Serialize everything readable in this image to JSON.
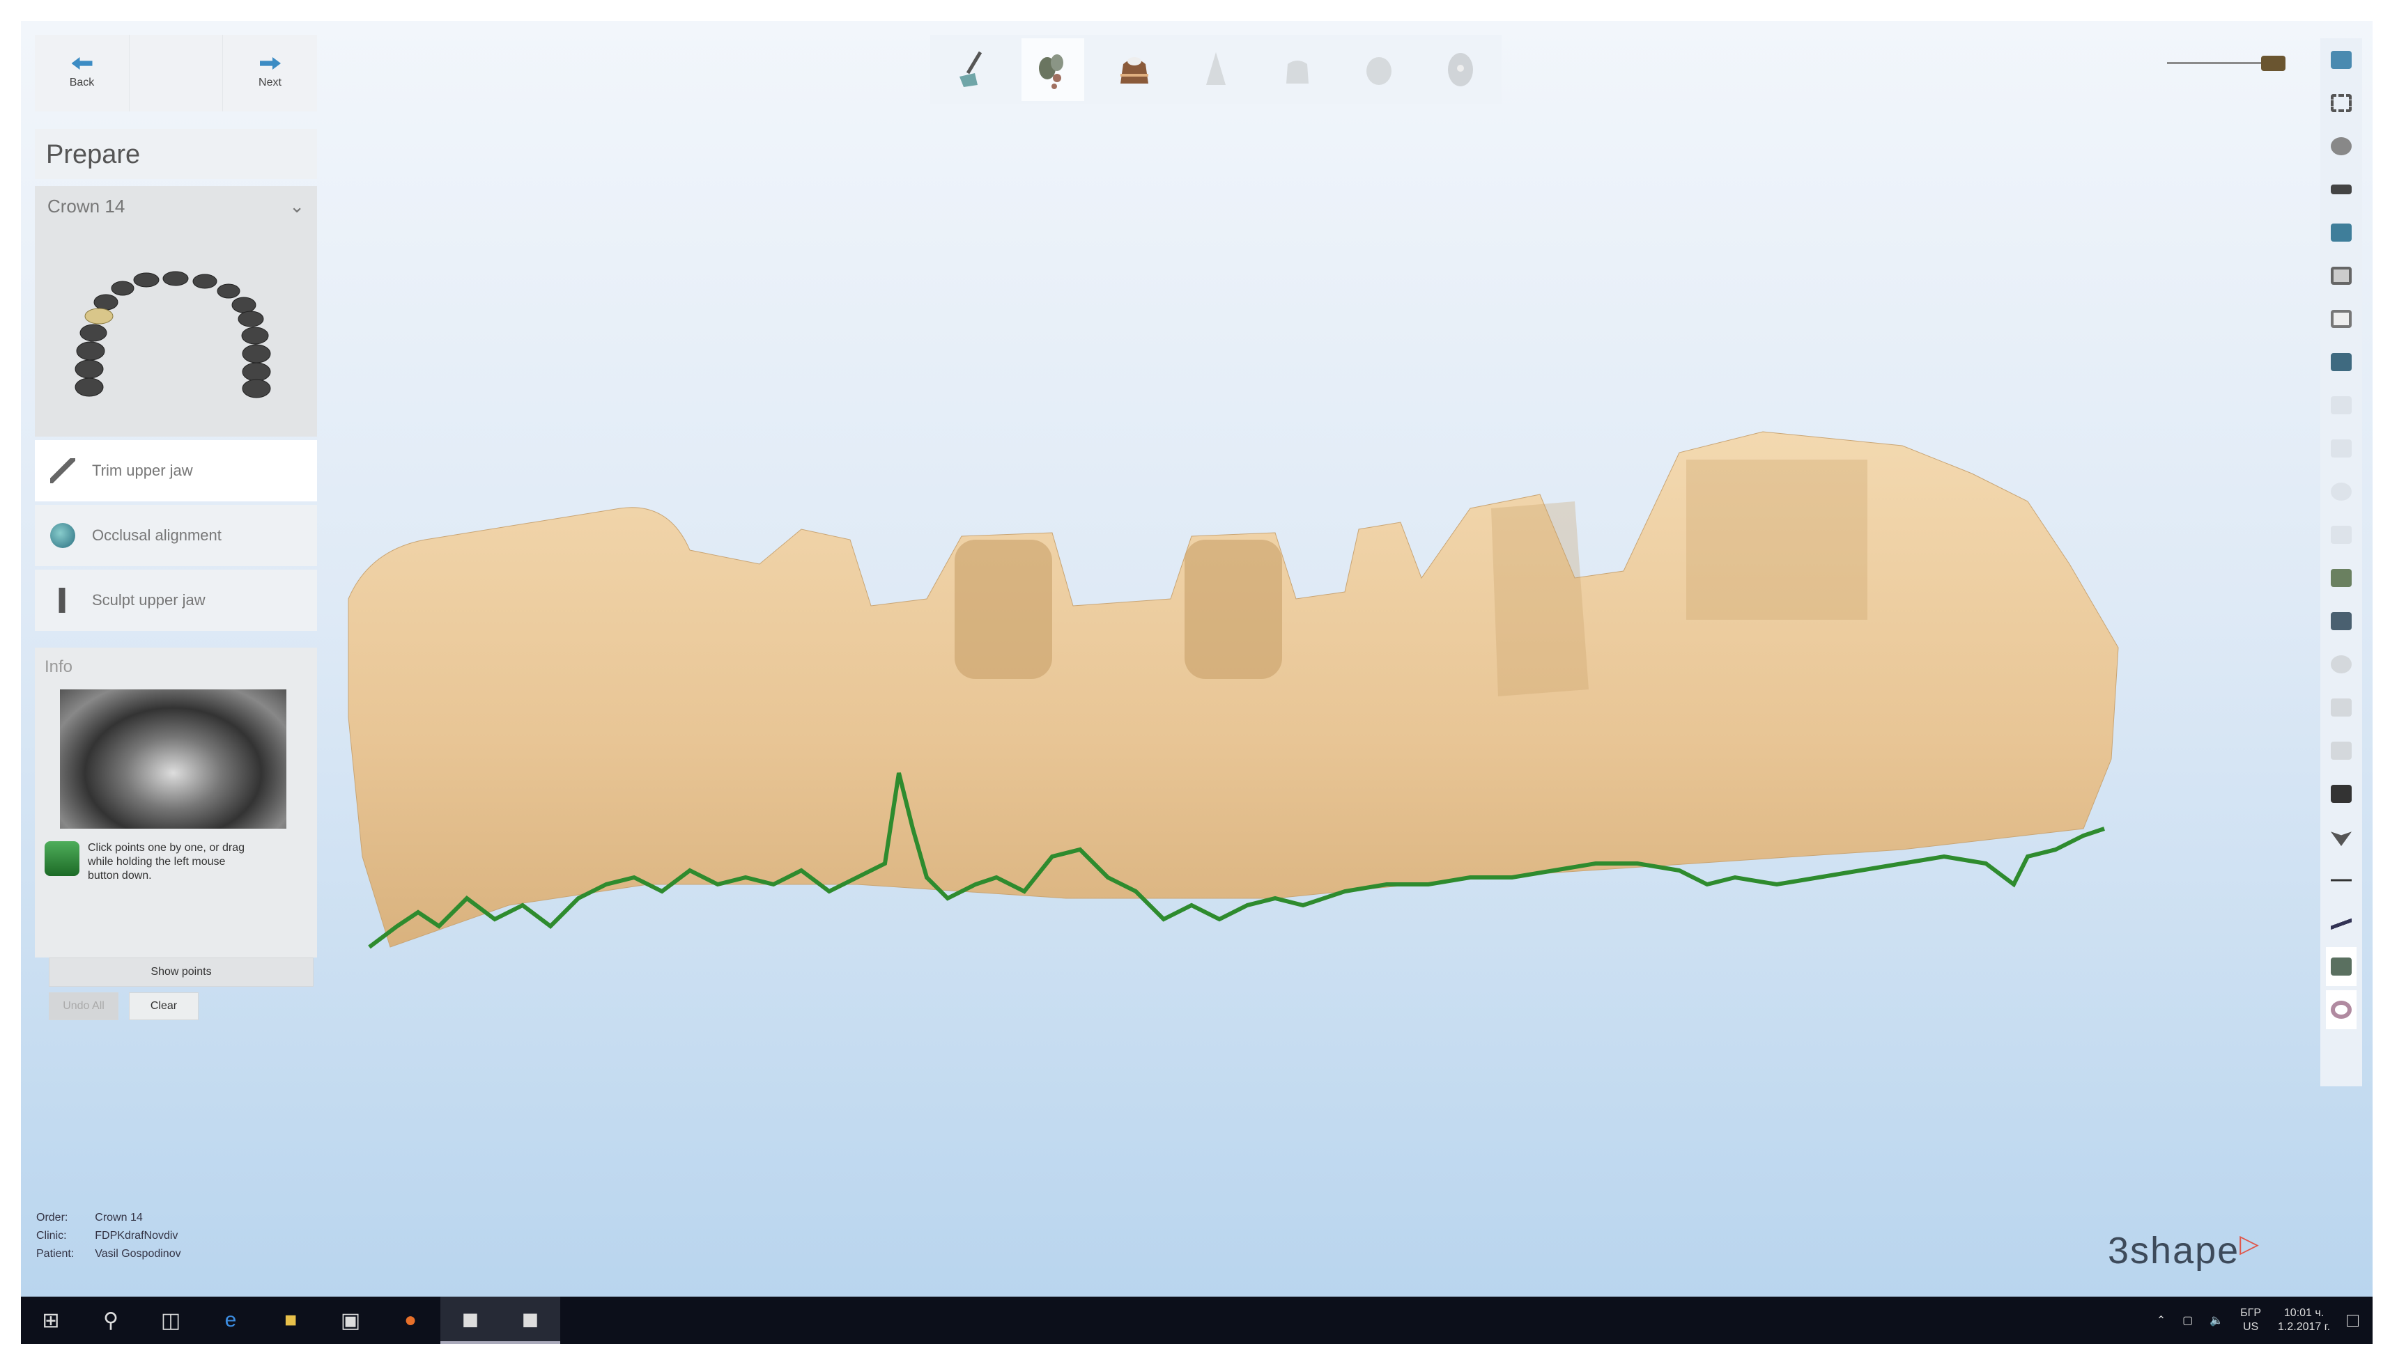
{
  "nav": {
    "back": "Back",
    "next": "Next"
  },
  "panel": {
    "title": "Prepare",
    "dropdown": "Crown 14",
    "steps": [
      {
        "label": "Trim upper jaw",
        "icon": "trim-icon"
      },
      {
        "label": "Occlusal alignment",
        "icon": "globe-icon"
      },
      {
        "label": "Sculpt upper jaw",
        "icon": "sculpt-icon"
      }
    ]
  },
  "info": {
    "title": "Info",
    "tip": "Click points one by one, or drag while holding the left mouse button down.",
    "show_points": "Show points",
    "undo": "Undo All",
    "clear": "Clear"
  },
  "order": {
    "order_label": "Order:",
    "order_value": "Crown 14",
    "clinic_label": "Clinic:",
    "clinic_value": "FDPKdrafNovdiv",
    "patient_label": "Patient:",
    "patient_value": "Vasil Gospodinov"
  },
  "toolbar": [
    "trim-tool-icon",
    "prepare-tool-icon",
    "model-tool-icon",
    "die-tool-icon",
    "crown-tool-icon",
    "anatomy-tool-icon",
    "sculpt-tool-icon"
  ],
  "logo": "3shape",
  "colors": {
    "model": "#e8c595",
    "margin_line": "#2e8b2e",
    "accent": "#3c8cc4"
  },
  "tray": {
    "lang_top": "БГР",
    "lang_bottom": "US",
    "time": "10:01 ч.",
    "date": "1.2.2017 г."
  }
}
